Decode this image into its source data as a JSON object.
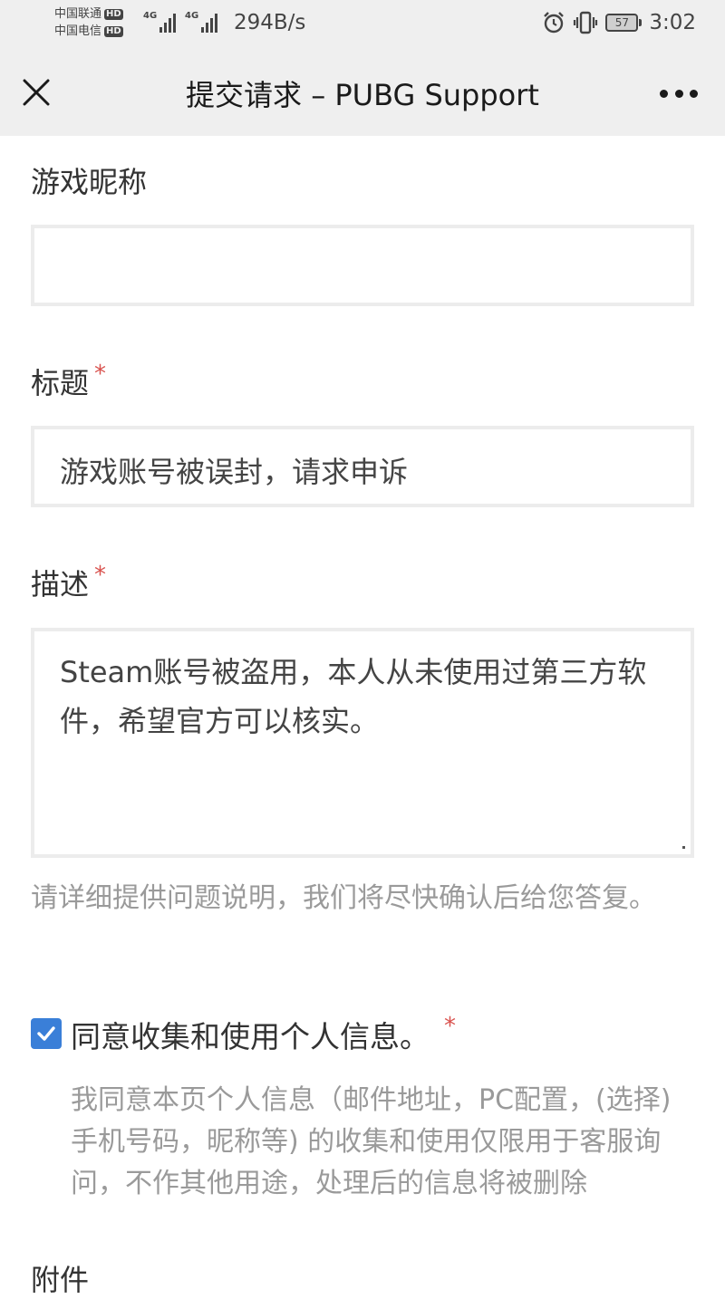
{
  "status_bar": {
    "carrier_1": "中国联通",
    "carrier_2": "中国电信",
    "hd_badge": "HD",
    "signal_1_tag": "4G",
    "signal_2_tag": "4G",
    "net_speed": "294B/s",
    "battery_level": "57",
    "time": "3:02",
    "icons": [
      "alarm-icon",
      "vibrate-icon",
      "battery-icon"
    ]
  },
  "nav": {
    "title": "提交请求 – PUBG Support",
    "close_icon": "close-icon",
    "more_icon": "more-icon"
  },
  "form": {
    "nickname": {
      "label": "游戏昵称",
      "value": ""
    },
    "subject": {
      "label": "标题",
      "required_mark": "*",
      "value": "游戏账号被误封，请求申诉"
    },
    "description": {
      "label": "描述",
      "required_mark": "*",
      "value": "Steam账号被盗用，本人从未使用过第三方软件，希望官方可以核实。",
      "hint": "请详细提供问题说明，我们将尽快确认后给您答复。"
    },
    "consent": {
      "checked": true,
      "label": "同意收集和使用个人信息。",
      "required_mark": "*",
      "detail": "我同意本页个人信息（邮件地址，PC配置，(选择)手机号码，昵称等) 的收集和使用仅限用于客服询问，不作其他用途，处理后的信息将被删除"
    },
    "attachments": {
      "label": "附件"
    }
  },
  "colors": {
    "bar_background": "#efefef",
    "accent_checkbox": "#3a7fd8",
    "required_mark": "#d9534f",
    "hint_text": "#9a9a9a",
    "input_border": "#ececec"
  }
}
